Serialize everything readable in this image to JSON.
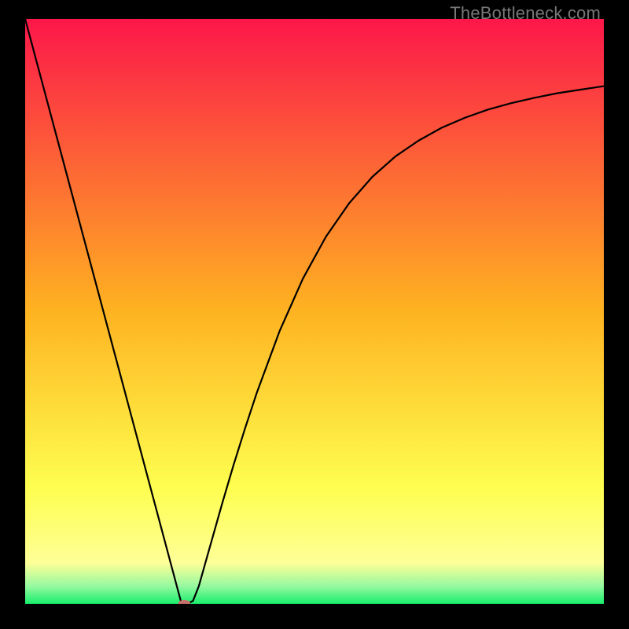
{
  "watermark": "TheBottleneck.com",
  "chart_data": {
    "type": "line",
    "title": "",
    "xlabel": "",
    "ylabel": "",
    "xlim": [
      0,
      100
    ],
    "ylim": [
      0,
      100
    ],
    "grid": false,
    "legend": false,
    "background_gradient": [
      {
        "stop": 0.0,
        "color": "#fc174a"
      },
      {
        "stop": 0.5,
        "color": "#feb321"
      },
      {
        "stop": 0.8,
        "color": "#fefe4f"
      },
      {
        "stop": 0.93,
        "color": "#feff97"
      },
      {
        "stop": 0.97,
        "color": "#95f9a0"
      },
      {
        "stop": 1.0,
        "color": "#18ee6c"
      }
    ],
    "series": [
      {
        "name": "bottleneck-curve",
        "x": [
          0,
          2,
          4,
          6,
          8,
          10,
          12,
          14,
          16,
          18,
          20,
          22,
          24,
          26,
          27,
          28,
          29,
          30,
          32,
          34,
          36,
          38,
          40,
          44,
          48,
          52,
          56,
          60,
          64,
          68,
          72,
          76,
          80,
          84,
          88,
          92,
          96,
          100
        ],
        "y": [
          100,
          92.6,
          85.2,
          77.8,
          70.4,
          63.0,
          55.6,
          48.2,
          40.8,
          33.4,
          26.0,
          18.6,
          11.2,
          3.8,
          0.1,
          0.0,
          0.5,
          3.0,
          10.0,
          17.0,
          23.7,
          30.0,
          36.0,
          46.7,
          55.6,
          62.8,
          68.5,
          73.0,
          76.5,
          79.2,
          81.4,
          83.1,
          84.5,
          85.6,
          86.5,
          87.3,
          87.9,
          88.5
        ]
      }
    ],
    "marker": {
      "x": 27.5,
      "y": 0.0,
      "color": "#c9706d"
    }
  }
}
